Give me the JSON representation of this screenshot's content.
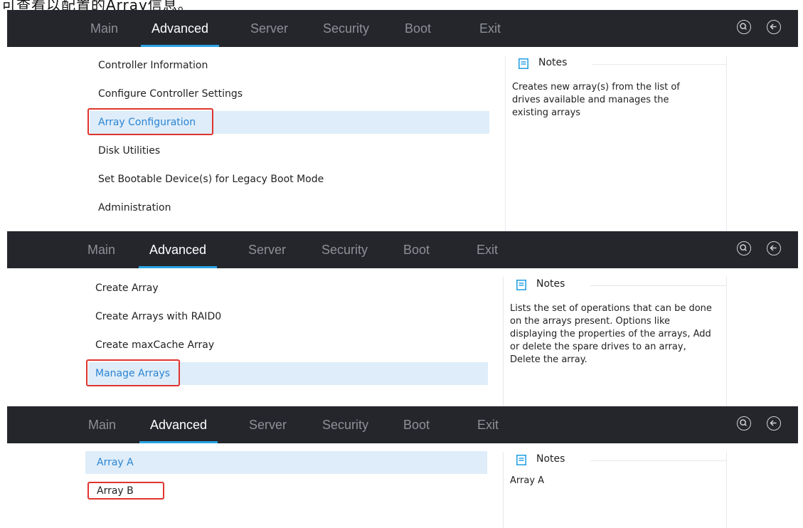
{
  "caption": "可查看以配置的Array信息。",
  "tabs": [
    "Main",
    "Advanced",
    "Server",
    "Security",
    "Boot",
    "Exit"
  ],
  "active_tab": "Advanced",
  "icons": {
    "search": "search-icon",
    "back": "back-arrow-icon"
  },
  "colors": {
    "topbar": "#24262c",
    "accent": "#2aa3e4",
    "selected_bg": "#deedf9",
    "selected_text": "#2c84d3",
    "highlight_box": "#e0342e"
  },
  "screens": [
    {
      "menu": [
        "Controller Information",
        "Configure Controller Settings",
        "Array Configuration",
        "Disk Utilities",
        "Set Bootable Device(s) for Legacy Boot Mode",
        "Administration"
      ],
      "selected_index": 2,
      "notes_title": "Notes",
      "notes_text": "Creates new array(s) from the list of drives available and manages the existing arrays"
    },
    {
      "menu": [
        "Create Array",
        "Create Arrays with RAID0",
        "Create maxCache Array",
        "Manage Arrays"
      ],
      "selected_index": 3,
      "notes_title": "Notes",
      "notes_text": "Lists the set of operations that can be done on the arrays present. Options like displaying the properties of the arrays, Add or delete the spare drives to an array, Delete the array."
    },
    {
      "menu": [
        "Array A",
        "Array B"
      ],
      "selected_index": 0,
      "notes_title": "Notes",
      "notes_text": "Array A"
    }
  ]
}
